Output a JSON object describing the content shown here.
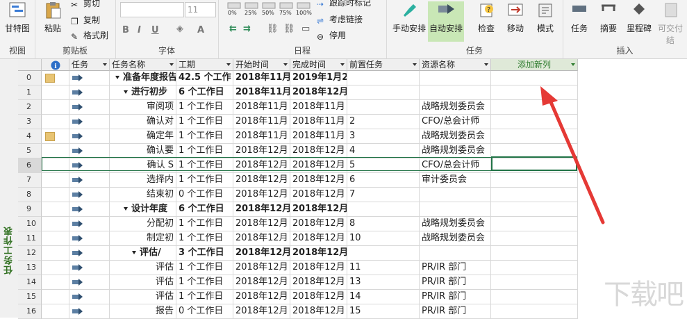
{
  "ribbon": {
    "view_group": {
      "gantt_label": "甘特图",
      "group_label": "视图"
    },
    "clipboard_group": {
      "paste_label": "粘贴",
      "cut_label": "剪切",
      "copy_label": "复制",
      "format_painter_label": "格式刷",
      "group_label": "剪贴板"
    },
    "font_group": {
      "font_size_value": "11",
      "group_label": "字体"
    },
    "schedule_group": {
      "pct_labels": [
        "0%",
        "25%",
        "50%",
        "75%",
        "100%"
      ],
      "mark_on_track_label": "跟踪时标记",
      "respect_links_label": "考虑链接",
      "inactivate_label": "停用",
      "group_label": "日程"
    },
    "tasks_group": {
      "manual_label": "手动安排",
      "auto_label": "自动安排",
      "inspect_label": "检查",
      "move_label": "移动",
      "mode_label": "模式",
      "group_label": "任务"
    },
    "insert_group": {
      "task_label": "任务",
      "summary_label": "摘要",
      "milestone_label": "里程碑",
      "deliverable_label": "可交付结",
      "group_label": "插入"
    }
  },
  "sidebar": {
    "view_name": "任务工作表"
  },
  "columns": {
    "info_icon": "information-icon",
    "mode": "任务",
    "name": "任务名称",
    "duration": "工期",
    "start": "开始时间",
    "finish": "完成时间",
    "predecessors": "前置任务",
    "resources": "资源名称",
    "add_column": "添加新列"
  },
  "rows": [
    {
      "id": "0",
      "note": true,
      "name": "准备年度报告",
      "duration": "42.5 个工作",
      "start": "2018年11月",
      "finish": "2019年1月2",
      "pred": "",
      "res": "",
      "level": 0,
      "summary": true
    },
    {
      "id": "1",
      "note": false,
      "name": "进行初步",
      "duration": "6 个工作日",
      "start": "2018年11月",
      "finish": "2018年12月",
      "pred": "",
      "res": "",
      "level": 1,
      "summary": true
    },
    {
      "id": "2",
      "note": false,
      "name": "审阅项",
      "duration": "1 个工作日",
      "start": "2018年11月",
      "finish": "2018年11月",
      "pred": "",
      "res": "战略规划委员会",
      "level": 2,
      "summary": false
    },
    {
      "id": "3",
      "note": false,
      "name": "确认对",
      "duration": "1 个工作日",
      "start": "2018年11月",
      "finish": "2018年11月",
      "pred": "2",
      "res": "CFO/总会计师",
      "level": 2,
      "summary": false
    },
    {
      "id": "4",
      "note": true,
      "name": "确定年",
      "duration": "1 个工作日",
      "start": "2018年11月",
      "finish": "2018年11月",
      "pred": "3",
      "res": "战略规划委员会",
      "level": 2,
      "summary": false
    },
    {
      "id": "5",
      "note": false,
      "name": "确认要",
      "duration": "1 个工作日",
      "start": "2018年12月",
      "finish": "2018年12月",
      "pred": "4",
      "res": "战略规划委员会",
      "level": 2,
      "summary": false
    },
    {
      "id": "6",
      "note": false,
      "name": "确认 S",
      "duration": "1 个工作日",
      "start": "2018年12月",
      "finish": "2018年12月",
      "pred": "5",
      "res": "CFO/总会计师",
      "level": 2,
      "summary": false
    },
    {
      "id": "7",
      "note": false,
      "name": "选择内",
      "duration": "1 个工作日",
      "start": "2018年12月",
      "finish": "2018年12月",
      "pred": "6",
      "res": "审计委员会",
      "level": 2,
      "summary": false
    },
    {
      "id": "8",
      "note": false,
      "name": "结束初",
      "duration": "0 个工作日",
      "start": "2018年12月",
      "finish": "2018年12月",
      "pred": "7",
      "res": "",
      "level": 2,
      "summary": false
    },
    {
      "id": "9",
      "note": false,
      "name": "设计年度",
      "duration": "6 个工作日",
      "start": "2018年12月",
      "finish": "2018年12月",
      "pred": "",
      "res": "",
      "level": 1,
      "summary": true
    },
    {
      "id": "10",
      "note": false,
      "name": "分配初",
      "duration": "1 个工作日",
      "start": "2018年12月",
      "finish": "2018年12月",
      "pred": "8",
      "res": "战略规划委员会",
      "level": 2,
      "summary": false
    },
    {
      "id": "11",
      "note": false,
      "name": "制定初",
      "duration": "1 个工作日",
      "start": "2018年12月",
      "finish": "2018年12月",
      "pred": "10",
      "res": "战略规划委员会",
      "level": 2,
      "summary": false
    },
    {
      "id": "12",
      "note": false,
      "name": "评估/",
      "duration": "3 个工作日",
      "start": "2018年12月",
      "finish": "2018年12月",
      "pred": "",
      "res": "",
      "level": 2,
      "summary": true
    },
    {
      "id": "13",
      "note": false,
      "name": "评估",
      "duration": "1 个工作日",
      "start": "2018年12月",
      "finish": "2018年12月",
      "pred": "11",
      "res": "PR/IR 部门",
      "level": 3,
      "summary": false
    },
    {
      "id": "14",
      "note": false,
      "name": "评估",
      "duration": "1 个工作日",
      "start": "2018年12月",
      "finish": "2018年12月",
      "pred": "13",
      "res": "PR/IR 部门",
      "level": 3,
      "summary": false
    },
    {
      "id": "15",
      "note": false,
      "name": "评估",
      "duration": "1 个工作日",
      "start": "2018年12月",
      "finish": "2018年12月",
      "pred": "14",
      "res": "PR/IR 部门",
      "level": 3,
      "summary": false
    },
    {
      "id": "16",
      "note": false,
      "name": "报告",
      "duration": "0 个工作日",
      "start": "2018年12月",
      "finish": "2018年12月",
      "pred": "15",
      "res": "PR/IR 部门",
      "level": 3,
      "summary": false
    }
  ],
  "colors": {
    "accent_green": "#217346",
    "annotation_red": "#e53935",
    "note_yellow": "#e8c473"
  }
}
